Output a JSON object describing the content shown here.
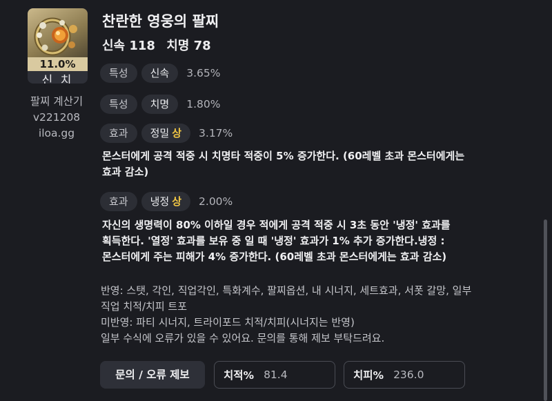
{
  "item": {
    "percent": "11.0%",
    "grade": "신 치"
  },
  "side": {
    "line1": "팔찌 계산기",
    "line2": "v221208",
    "line3": "iloa.gg"
  },
  "title": "찬란한 영웅의 팔찌",
  "stats": {
    "swift": "신속 118",
    "crit": "치명 78"
  },
  "effects": [
    {
      "tag": "특성",
      "name": "신속",
      "grade": "",
      "value": "3.65%"
    },
    {
      "tag": "특성",
      "name": "치명",
      "grade": "",
      "value": "1.80%"
    },
    {
      "tag": "효과",
      "name": "정밀",
      "grade": "상",
      "value": "3.17%"
    },
    {
      "tag": "효과",
      "name": "냉정",
      "grade": "상",
      "value": "2.00%"
    }
  ],
  "descriptions": {
    "precision_line1": "몬스터에게 공격 적중 시 치명타 적중이 5% 증가한다. (60레벨 초과 몬스터에게는",
    "precision_line2": "효과 감소)",
    "calm_line1": "자신의 생명력이 80% 이하일 경우 적에게 공격 적중 시 3초 동안 '냉정' 효과를",
    "calm_line2": "획득한다. '열정' 효과를 보유 중 일 때 '냉정' 효과가 1% 추가 증가한다.냉정 :",
    "calm_line3": "몬스터에게 주는 피해가 4% 증가한다. (60레벨 초과 몬스터에게는 효과 감소)"
  },
  "notes": {
    "applied_line1": "반영: 스탯, 각인, 직업각인, 특화계수, 팔찌옵션, 내 시너지, 세트효과, 서폿 갈망, 일부",
    "applied_line2": "직업 치적/치피 트포",
    "not_applied": "미반영: 파티 시너지, 트라이포드 치적/치피(시너지는 반영)",
    "disclaimer": "일부 수식에 오류가 있을 수 있어요. 문의를 통해 제보 부탁드려요."
  },
  "bottom": {
    "report_label": "문의 / 오류 제보",
    "crit_rate_label": "치적%",
    "crit_rate_value": "81.4",
    "crit_dmg_label": "치피%",
    "crit_dmg_value": "236.0"
  },
  "colors": {
    "background": "#1b1c21",
    "chip": "#2c2e35",
    "grade_high": "#f2c744",
    "item_percent_bg": "#d9caa0"
  },
  "icons": {
    "item": "bracelet-icon"
  }
}
